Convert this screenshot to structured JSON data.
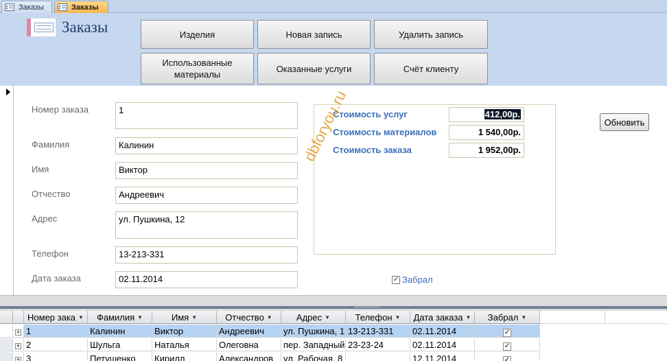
{
  "tabs": [
    {
      "label": "Заказы",
      "active": false
    },
    {
      "label": "Заказы",
      "active": true
    }
  ],
  "header": {
    "title": "Заказы",
    "buttons": {
      "products": "Изделия",
      "new_record": "Новая запись",
      "delete_record": "Удалить запись",
      "used_materials": "Использованные материалы",
      "services": "Оказанные услуги",
      "invoice": "Счёт клиенту"
    }
  },
  "form": {
    "order_number": {
      "label": "Номер заказа",
      "value": "1"
    },
    "last_name": {
      "label": "Фамилия",
      "value": "Калинин"
    },
    "first_name": {
      "label": "Имя",
      "value": "Виктор"
    },
    "patronymic": {
      "label": "Отчество",
      "value": "Андреевич"
    },
    "address": {
      "label": "Адрес",
      "value": "ул. Пушкина, 12"
    },
    "phone": {
      "label": "Телефон",
      "value": "13-213-331"
    },
    "order_date": {
      "label": "Дата заказа",
      "value": "02.11.2014"
    },
    "picked_up": {
      "label": "Забрал",
      "checked": true
    }
  },
  "summary": {
    "services": {
      "label": "Стоимость услуг",
      "value": "412,00р."
    },
    "materials": {
      "label": "Стоимость материалов",
      "value": "1 540,00р."
    },
    "total": {
      "label": "Стоимость заказа",
      "value": "1 952,00р."
    }
  },
  "refresh_label": "Обновить",
  "watermark": "dbforyou.ru",
  "grid": {
    "columns": [
      "Номер зака",
      "Фамилия",
      "Имя",
      "Отчество",
      "Адрес",
      "Телефон",
      "Дата заказа",
      "Забрал"
    ],
    "rows": [
      {
        "num": "1",
        "last": "Калинин",
        "first": "Виктор",
        "patr": "Андреевич",
        "addr": "ул. Пушкина, 1",
        "phone": "13-213-331",
        "date": "02.11.2014",
        "taken": true
      },
      {
        "num": "2",
        "last": "Шульга",
        "first": "Наталья",
        "patr": "Олеговна",
        "addr": "пер. Западный",
        "phone": "23-23-24",
        "date": "02.11.2014",
        "taken": true
      },
      {
        "num": "3",
        "last": "Петушенко",
        "first": "Кирилл",
        "patr": "Александров",
        "addr": "ул. Рабочая, 8",
        "phone": "",
        "date": "12.11.2014",
        "taken": true
      }
    ]
  },
  "colors": {
    "header_bg": "#c6d8f0",
    "accent_label": "#3a6fbf",
    "active_tab": "#f7b64e",
    "selected_row": "#b7d3f2",
    "watermark": "#e39a2a"
  }
}
